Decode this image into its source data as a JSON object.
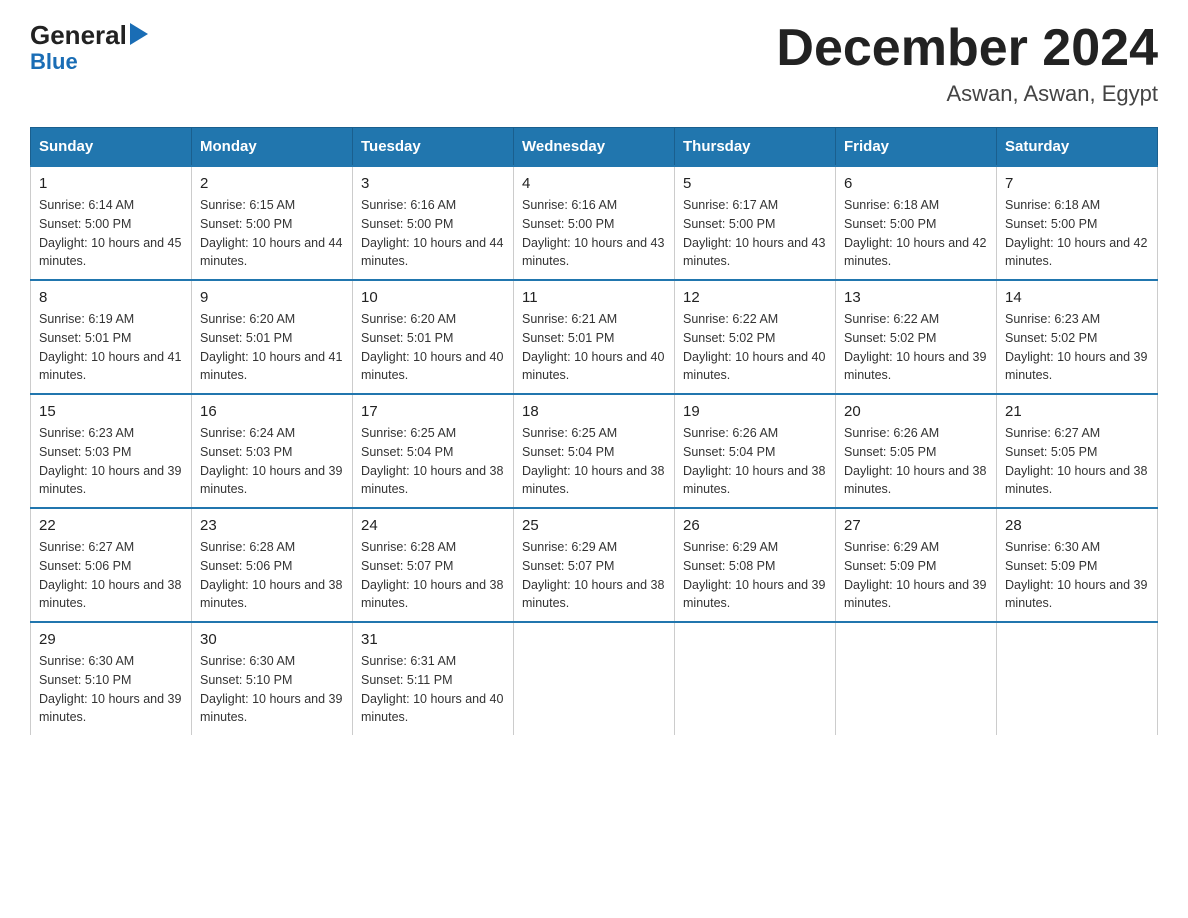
{
  "logo": {
    "general": "General",
    "blue": "Blue",
    "arrow_char": "▶"
  },
  "title": "December 2024",
  "subtitle": "Aswan, Aswan, Egypt",
  "days_of_week": [
    "Sunday",
    "Monday",
    "Tuesday",
    "Wednesday",
    "Thursday",
    "Friday",
    "Saturday"
  ],
  "weeks": [
    {
      "days": [
        {
          "num": "1",
          "sunrise": "6:14 AM",
          "sunset": "5:00 PM",
          "daylight": "10 hours and 45 minutes."
        },
        {
          "num": "2",
          "sunrise": "6:15 AM",
          "sunset": "5:00 PM",
          "daylight": "10 hours and 44 minutes."
        },
        {
          "num": "3",
          "sunrise": "6:16 AM",
          "sunset": "5:00 PM",
          "daylight": "10 hours and 44 minutes."
        },
        {
          "num": "4",
          "sunrise": "6:16 AM",
          "sunset": "5:00 PM",
          "daylight": "10 hours and 43 minutes."
        },
        {
          "num": "5",
          "sunrise": "6:17 AM",
          "sunset": "5:00 PM",
          "daylight": "10 hours and 43 minutes."
        },
        {
          "num": "6",
          "sunrise": "6:18 AM",
          "sunset": "5:00 PM",
          "daylight": "10 hours and 42 minutes."
        },
        {
          "num": "7",
          "sunrise": "6:18 AM",
          "sunset": "5:00 PM",
          "daylight": "10 hours and 42 minutes."
        }
      ]
    },
    {
      "days": [
        {
          "num": "8",
          "sunrise": "6:19 AM",
          "sunset": "5:01 PM",
          "daylight": "10 hours and 41 minutes."
        },
        {
          "num": "9",
          "sunrise": "6:20 AM",
          "sunset": "5:01 PM",
          "daylight": "10 hours and 41 minutes."
        },
        {
          "num": "10",
          "sunrise": "6:20 AM",
          "sunset": "5:01 PM",
          "daylight": "10 hours and 40 minutes."
        },
        {
          "num": "11",
          "sunrise": "6:21 AM",
          "sunset": "5:01 PM",
          "daylight": "10 hours and 40 minutes."
        },
        {
          "num": "12",
          "sunrise": "6:22 AM",
          "sunset": "5:02 PM",
          "daylight": "10 hours and 40 minutes."
        },
        {
          "num": "13",
          "sunrise": "6:22 AM",
          "sunset": "5:02 PM",
          "daylight": "10 hours and 39 minutes."
        },
        {
          "num": "14",
          "sunrise": "6:23 AM",
          "sunset": "5:02 PM",
          "daylight": "10 hours and 39 minutes."
        }
      ]
    },
    {
      "days": [
        {
          "num": "15",
          "sunrise": "6:23 AM",
          "sunset": "5:03 PM",
          "daylight": "10 hours and 39 minutes."
        },
        {
          "num": "16",
          "sunrise": "6:24 AM",
          "sunset": "5:03 PM",
          "daylight": "10 hours and 39 minutes."
        },
        {
          "num": "17",
          "sunrise": "6:25 AM",
          "sunset": "5:04 PM",
          "daylight": "10 hours and 38 minutes."
        },
        {
          "num": "18",
          "sunrise": "6:25 AM",
          "sunset": "5:04 PM",
          "daylight": "10 hours and 38 minutes."
        },
        {
          "num": "19",
          "sunrise": "6:26 AM",
          "sunset": "5:04 PM",
          "daylight": "10 hours and 38 minutes."
        },
        {
          "num": "20",
          "sunrise": "6:26 AM",
          "sunset": "5:05 PM",
          "daylight": "10 hours and 38 minutes."
        },
        {
          "num": "21",
          "sunrise": "6:27 AM",
          "sunset": "5:05 PM",
          "daylight": "10 hours and 38 minutes."
        }
      ]
    },
    {
      "days": [
        {
          "num": "22",
          "sunrise": "6:27 AM",
          "sunset": "5:06 PM",
          "daylight": "10 hours and 38 minutes."
        },
        {
          "num": "23",
          "sunrise": "6:28 AM",
          "sunset": "5:06 PM",
          "daylight": "10 hours and 38 minutes."
        },
        {
          "num": "24",
          "sunrise": "6:28 AM",
          "sunset": "5:07 PM",
          "daylight": "10 hours and 38 minutes."
        },
        {
          "num": "25",
          "sunrise": "6:29 AM",
          "sunset": "5:07 PM",
          "daylight": "10 hours and 38 minutes."
        },
        {
          "num": "26",
          "sunrise": "6:29 AM",
          "sunset": "5:08 PM",
          "daylight": "10 hours and 39 minutes."
        },
        {
          "num": "27",
          "sunrise": "6:29 AM",
          "sunset": "5:09 PM",
          "daylight": "10 hours and 39 minutes."
        },
        {
          "num": "28",
          "sunrise": "6:30 AM",
          "sunset": "5:09 PM",
          "daylight": "10 hours and 39 minutes."
        }
      ]
    },
    {
      "days": [
        {
          "num": "29",
          "sunrise": "6:30 AM",
          "sunset": "5:10 PM",
          "daylight": "10 hours and 39 minutes."
        },
        {
          "num": "30",
          "sunrise": "6:30 AM",
          "sunset": "5:10 PM",
          "daylight": "10 hours and 39 minutes."
        },
        {
          "num": "31",
          "sunrise": "6:31 AM",
          "sunset": "5:11 PM",
          "daylight": "10 hours and 40 minutes."
        },
        null,
        null,
        null,
        null
      ]
    }
  ],
  "labels": {
    "sunrise": "Sunrise:",
    "sunset": "Sunset:",
    "daylight": "Daylight:"
  },
  "colors": {
    "header_bg": "#2176ae",
    "header_text": "#ffffff",
    "week_border": "#2176ae"
  }
}
